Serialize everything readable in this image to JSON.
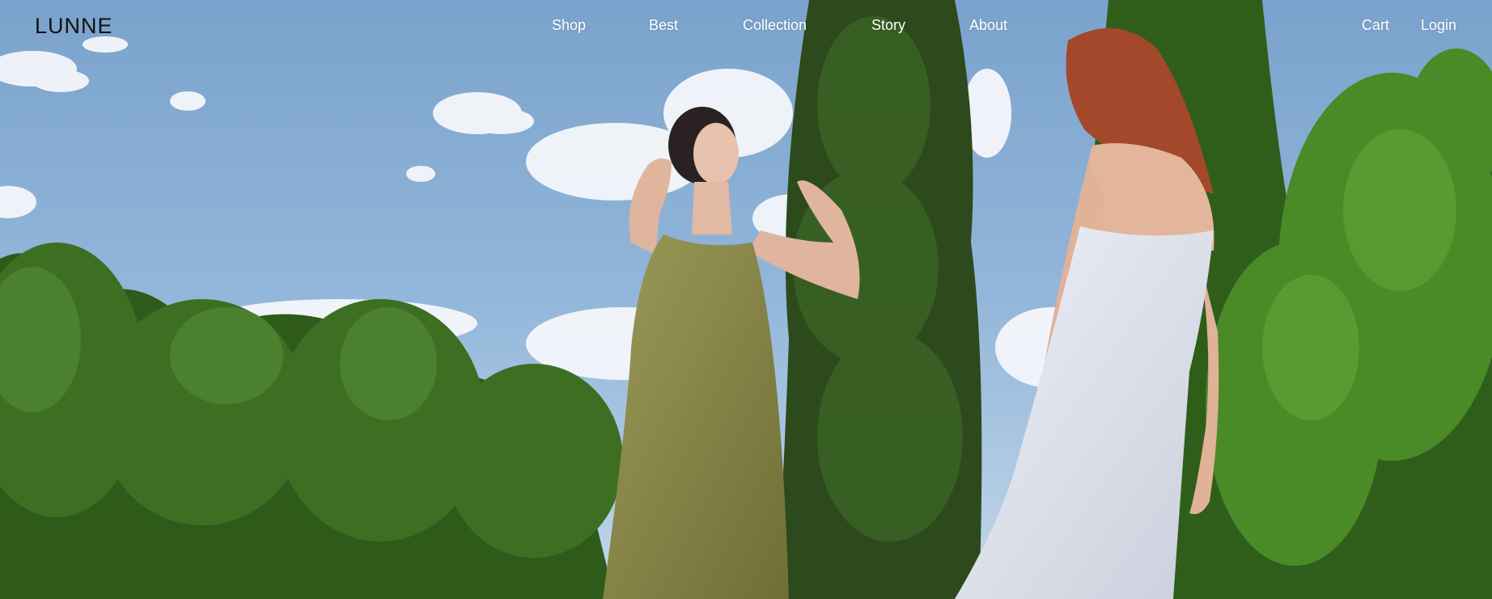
{
  "brand": {
    "logo_text": "LUNNE"
  },
  "nav": {
    "items": [
      {
        "label": "Shop"
      },
      {
        "label": "Best"
      },
      {
        "label": "Collection"
      },
      {
        "label": "Story"
      },
      {
        "label": "About"
      }
    ]
  },
  "utility": {
    "cart_label": "Cart",
    "login_label": "Login"
  },
  "colors": {
    "nav_text": "#ffffff",
    "logo_text": "#111111",
    "sky": "#8fb3d8",
    "foliage": "#2f5a1c",
    "olive_dress": "#8c8a4c",
    "white_dress": "#dfe3ec",
    "hair_red": "#a3482a"
  }
}
